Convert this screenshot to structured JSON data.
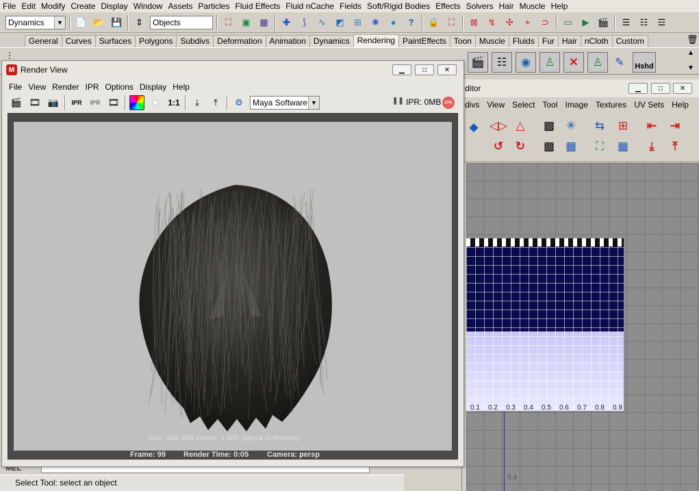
{
  "menubar": [
    "File",
    "Edit",
    "Modify",
    "Create",
    "Display",
    "Window",
    "Assets",
    "Particles",
    "Fluid Effects",
    "Fluid nCache",
    "Fields",
    "Soft/Rigid Bodies",
    "Effects",
    "Solvers",
    "Hair",
    "Muscle",
    "Help"
  ],
  "status": {
    "mode_value": "Dynamics",
    "objects_field": "Objects"
  },
  "shelf_tabs": [
    "General",
    "Curves",
    "Surfaces",
    "Polygons",
    "Subdivs",
    "Deformation",
    "Animation",
    "Dynamics",
    "Rendering",
    "PaintEffects",
    "Toon",
    "Muscle",
    "Fluids",
    "Fur",
    "Hair",
    "nCloth",
    "Custom"
  ],
  "shelf_active": "Rendering",
  "shelf_icon_label": "Hshd",
  "render_view": {
    "title": "Render View",
    "menu": [
      "File",
      "View",
      "Render",
      "IPR",
      "Options",
      "Display",
      "Help"
    ],
    "ratio_label": "1:1",
    "renderer": "Maya Software",
    "ipr_status": "IPR: 0MB",
    "ipr_badge": "IPR",
    "info_line1": "size:  640  480 zoom: 1.000      (Maya Software)",
    "info_frame": "Frame: 99",
    "info_render_time": "Render Time: 0:05",
    "info_camera": "Camera: persp"
  },
  "uv_editor": {
    "title_fragment": "ditor",
    "menu": [
      "divs",
      "View",
      "Select",
      "Tool",
      "Image",
      "Textures",
      "UV Sets",
      "Help"
    ],
    "ticks": [
      "0.1",
      "0.2",
      "0.3",
      "0.4",
      "0.5",
      "0.6",
      "0.7",
      "0.8",
      "0.9"
    ],
    "side_number": "0.4"
  },
  "command_line": {
    "label": "MEL"
  },
  "help_line": "Select Tool: select an object",
  "colors": {
    "texture_dark": "#0a0a4e",
    "texture_light": "#c9c9f6",
    "render_bg": "#c0c0c0",
    "hair": "#2b2a26"
  }
}
